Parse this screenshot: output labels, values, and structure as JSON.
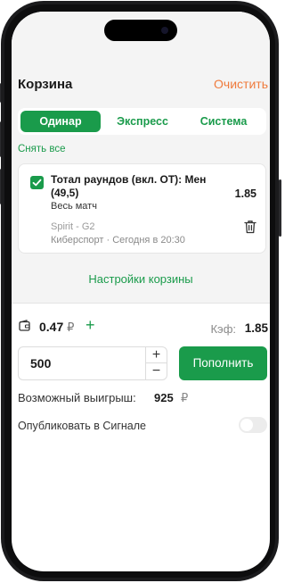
{
  "header": {
    "title": "Корзина",
    "clear_label": "Очистить"
  },
  "tabs": [
    {
      "label": "Одинар",
      "active": true
    },
    {
      "label": "Экспресс",
      "active": false
    },
    {
      "label": "Система",
      "active": false
    }
  ],
  "deselect_label": "Снять все",
  "bet": {
    "checked": true,
    "title": "Тотал раундов (вкл. ОТ): Мен (49,5)",
    "subtitle": "Весь матч",
    "coefficient": "1.85",
    "match": "Spirit - G2",
    "sport_time": "Киберспорт · Сегодня в 20:30"
  },
  "settings_link": "Настройки корзины",
  "balance": {
    "amount": "0.47",
    "currency": "₽"
  },
  "coef": {
    "label": "Кэф:",
    "value": "1.85"
  },
  "stake": {
    "value": "500",
    "plus": "+",
    "minus": "−"
  },
  "deposit_label": "Пополнить",
  "payout": {
    "label": "Возможный выигрыш:",
    "value": "925",
    "currency": "₽"
  },
  "publish": {
    "label": "Опубликовать в Сигнале",
    "enabled": false
  },
  "colors": {
    "accent": "#1a9b4b",
    "clear": "#ef7b3d"
  }
}
